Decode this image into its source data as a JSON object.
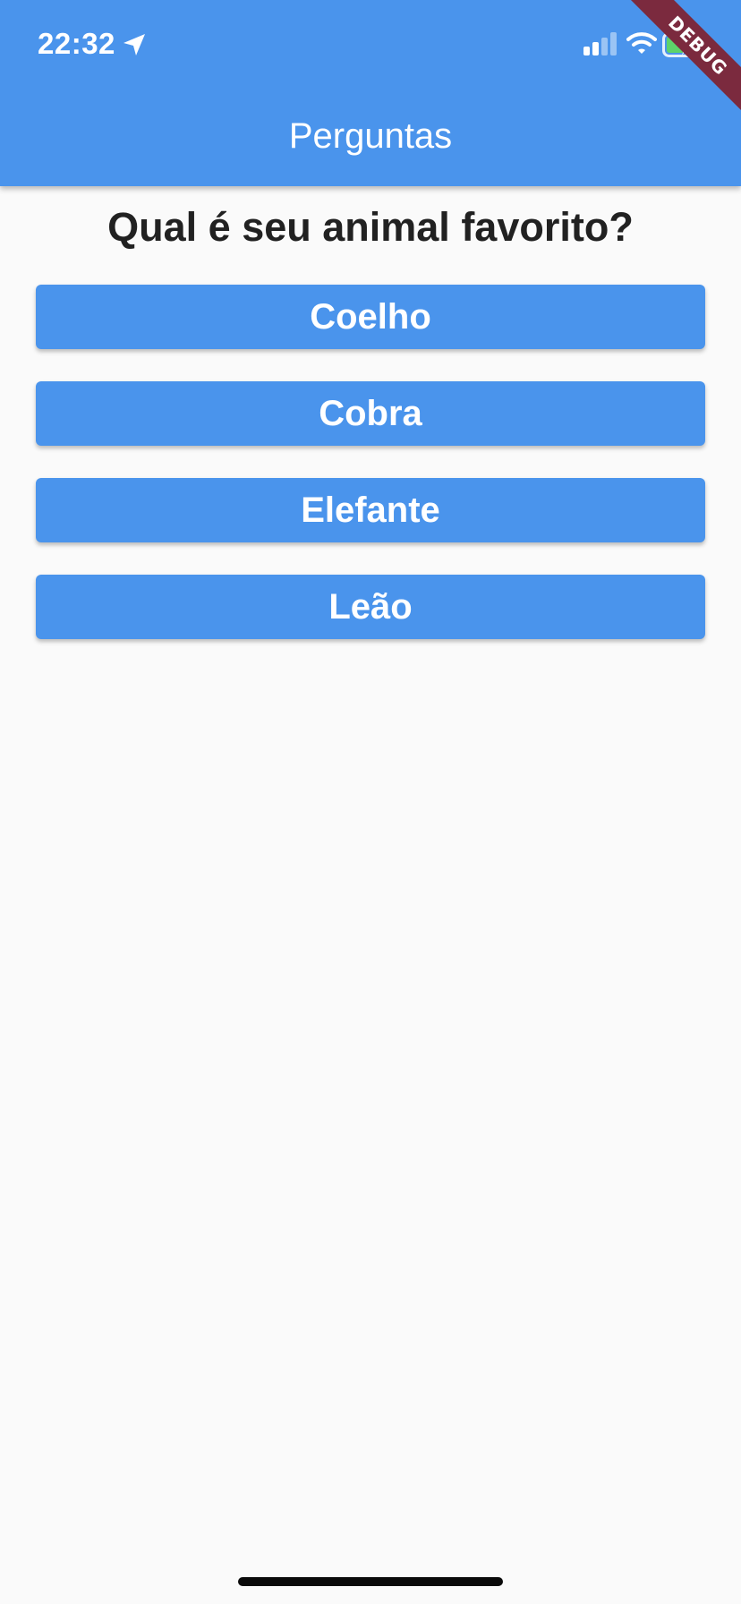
{
  "status_bar": {
    "time": "22:32",
    "icons": [
      "location-arrow-icon",
      "signal-icon",
      "wifi-icon",
      "battery-charging-icon"
    ]
  },
  "app_bar": {
    "title": "Perguntas",
    "color": "#4a94ec"
  },
  "debug_banner": {
    "label": "DEBUG",
    "color": "#7b2a3e"
  },
  "question": {
    "text": "Qual é seu animal favorito?"
  },
  "answers": [
    {
      "label": "Coelho"
    },
    {
      "label": "Cobra"
    },
    {
      "label": "Elefante"
    },
    {
      "label": "Leão"
    }
  ],
  "colors": {
    "accent": "#4a94ec",
    "background": "#fafafa",
    "question_text": "#212121"
  }
}
